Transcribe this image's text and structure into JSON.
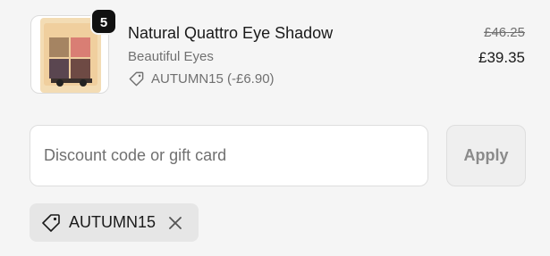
{
  "line_item": {
    "quantity": "5",
    "title": "Natural Quattro Eye Shadow",
    "variant": "Beautiful Eyes",
    "discount_label": "AUTUMN15 (-£6.90)",
    "original_price": "£46.25",
    "final_price": "£39.35",
    "thumbnail_icon": "eyeshadow-palette-icon"
  },
  "discount_form": {
    "placeholder": "Discount code or gift card",
    "value": "",
    "apply_label": "Apply"
  },
  "applied_discount": {
    "code": "AUTUMN15",
    "remove_icon": "close-icon",
    "tag_icon": "tag-icon"
  },
  "colors": {
    "background": "#f5f5f5",
    "text": "#1a1a1a",
    "muted": "#707070",
    "badge": "#111111",
    "chip": "#e6e6e6"
  }
}
